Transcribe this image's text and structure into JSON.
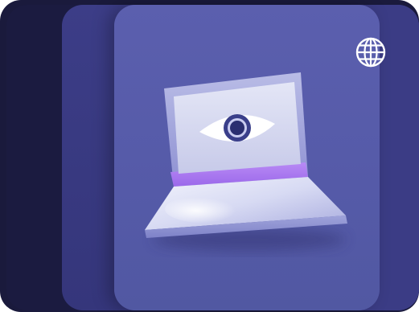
{
  "illustration": {
    "subject": "laptop-with-eye",
    "icon": "eye-icon"
  },
  "toolbar": {
    "globe_icon": "globe-icon"
  },
  "colors": {
    "background_dark": "#1a1a3c",
    "card_middle": "#3c3d87",
    "card_front": "#5a5ead",
    "laptop_screen": "#d6d8f0",
    "laptop_frame": "#8a8ed4",
    "accent_purple": "#a46cf0",
    "eye_iris": "#3a3f8a",
    "globe_stroke": "#ffffff"
  }
}
